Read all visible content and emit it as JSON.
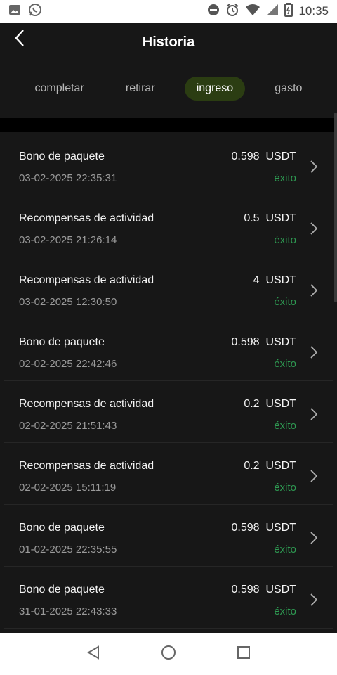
{
  "status_bar": {
    "time": "10:35",
    "left_icons": [
      "image-icon",
      "whatsapp-icon"
    ],
    "right_icons": [
      "do-not-disturb-icon",
      "alarm-icon",
      "wifi-icon",
      "signal-icon",
      "battery-icon"
    ]
  },
  "header": {
    "title": "Historia",
    "back_icon": "chevron-left-icon"
  },
  "tabs": [
    {
      "label": "completar",
      "active": false
    },
    {
      "label": "retirar",
      "active": false
    },
    {
      "label": "ingreso",
      "active": true
    },
    {
      "label": "gasto",
      "active": false
    }
  ],
  "records": [
    {
      "title": "Bono de paquete",
      "date": "03-02-2025 22:35:31",
      "amount": "0.598  USDT",
      "status": "éxito"
    },
    {
      "title": "Recompensas de actividad",
      "date": "03-02-2025 21:26:14",
      "amount": "0.5  USDT",
      "status": "éxito"
    },
    {
      "title": "Recompensas de actividad",
      "date": "03-02-2025 12:30:50",
      "amount": "4  USDT",
      "status": "éxito"
    },
    {
      "title": "Bono de paquete",
      "date": "02-02-2025 22:42:46",
      "amount": "0.598  USDT",
      "status": "éxito"
    },
    {
      "title": "Recompensas de actividad",
      "date": "02-02-2025 21:51:43",
      "amount": "0.2  USDT",
      "status": "éxito"
    },
    {
      "title": "Recompensas de actividad",
      "date": "02-02-2025 15:11:19",
      "amount": "0.2  USDT",
      "status": "éxito"
    },
    {
      "title": "Bono de paquete",
      "date": "01-02-2025 22:35:55",
      "amount": "0.598  USDT",
      "status": "éxito"
    },
    {
      "title": "Bono de paquete",
      "date": "31-01-2025 22:43:33",
      "amount": "0.598  USDT",
      "status": "éxito"
    }
  ],
  "colors": {
    "background": "#171717",
    "active_tab": "#2b3d12",
    "success": "#2e9a52",
    "text_primary": "#f4f4f4",
    "text_secondary": "#9a9a9a"
  },
  "nav_bar": {
    "icons": [
      "back-triangle-icon",
      "home-circle-icon",
      "recents-square-icon"
    ]
  }
}
